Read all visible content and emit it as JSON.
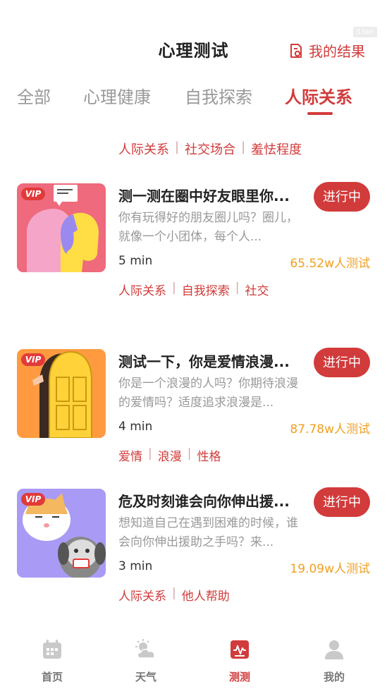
{
  "status_badge": "53ah",
  "header": {
    "title": "心理测试",
    "my_result": "我的结果"
  },
  "tabs": [
    {
      "label": "全部",
      "active": false
    },
    {
      "label": "心理健康",
      "active": false
    },
    {
      "label": "自我探索",
      "active": false
    },
    {
      "label": "人际关系",
      "active": true
    }
  ],
  "filter_tags": [
    "人际关系",
    "社交场合",
    "羞怯程度"
  ],
  "cards": [
    {
      "vip": "VIP",
      "title": "测一测在圈中好友眼里你...",
      "desc": "你有玩得好的朋友圈儿吗？圈儿，就像一个小团体，每个人...",
      "status": "进行中",
      "duration": "5 min",
      "count": "65.52w人测试",
      "tags": [
        "人际关系",
        "自我探索",
        "社交"
      ]
    },
    {
      "vip": "VIP",
      "title": "测试一下，你是爱情浪漫...",
      "desc": "你是一个浪漫的人吗？你期待浪漫的爱情吗？适度追求浪漫是...",
      "status": "进行中",
      "duration": "4 min",
      "count": "87.78w人测试",
      "tags": [
        "爱情",
        "浪漫",
        "性格"
      ]
    },
    {
      "vip": "VIP",
      "title": "危及时刻谁会向你伸出援...",
      "desc": "想知道自己在遇到困难的时候，谁会向你伸出援助之手吗？来...",
      "status": "进行中",
      "duration": "3 min",
      "count": "19.09w人测试",
      "tags": [
        "人际关系",
        "他人帮助"
      ]
    }
  ],
  "bottom_nav": [
    {
      "label": "首页",
      "icon": "calendar-icon",
      "active": false
    },
    {
      "label": "天气",
      "icon": "weather-icon",
      "active": false
    },
    {
      "label": "测测",
      "icon": "pulse-icon",
      "active": true
    },
    {
      "label": "我的",
      "icon": "user-icon",
      "active": false
    }
  ],
  "colors": {
    "accent": "#d23b3b",
    "count": "#f0a020",
    "muted": "#999999"
  }
}
